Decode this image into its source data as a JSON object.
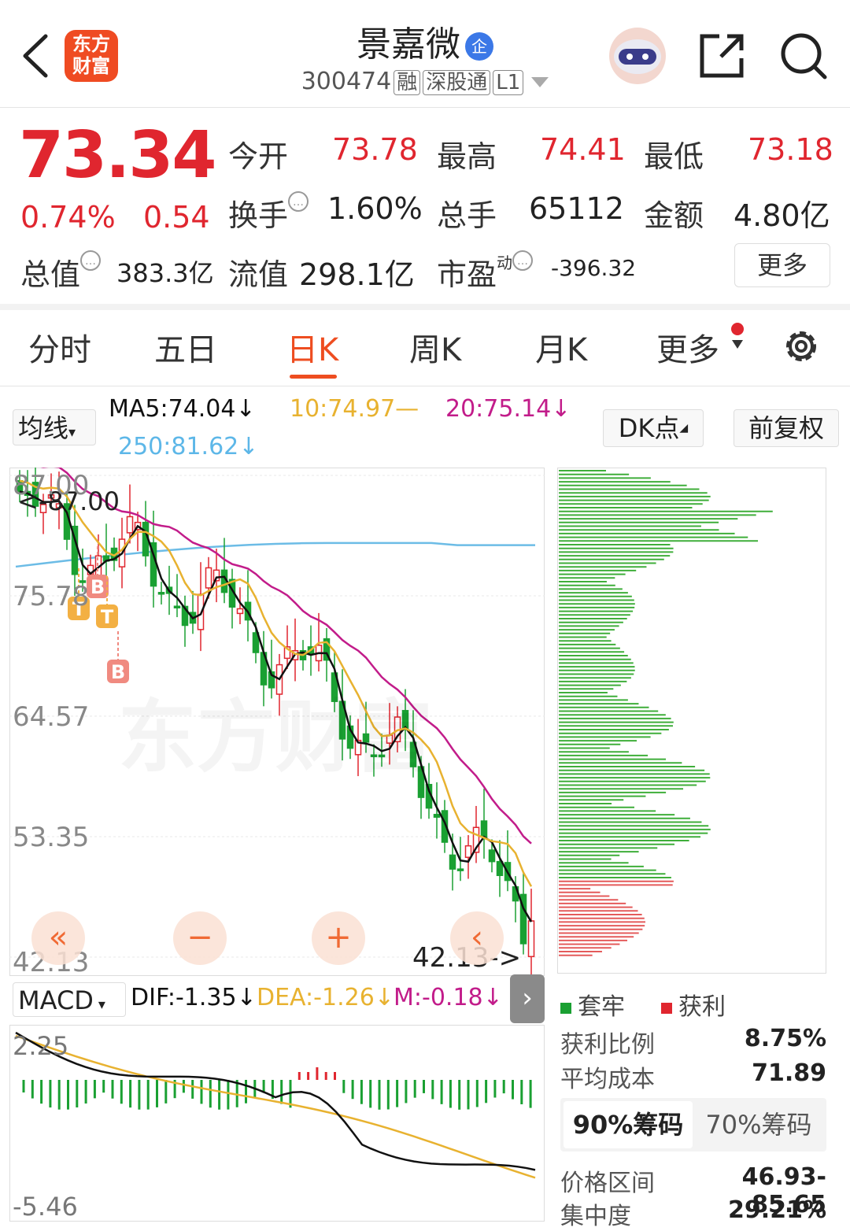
{
  "header": {
    "logo_text_line1": "东方",
    "logo_text_line2": "财富",
    "stock_name": "景嘉微",
    "badge": "企",
    "code": "300474",
    "tags": [
      "融",
      "深股通",
      "L1"
    ]
  },
  "quote": {
    "price": "73.34",
    "change_pct": "0.74%",
    "change": "0.54",
    "open_label": "今开",
    "open": "73.78",
    "high_label": "最高",
    "high": "74.41",
    "low_label": "最低",
    "low": "73.18",
    "turnover_label": "换手",
    "turnover": "1.60%",
    "volume_label": "总手",
    "volume": "65112",
    "amount_label": "金额",
    "amount": "4.80亿",
    "mcap_label": "总值",
    "mcap": "383.3亿",
    "float_label": "流值",
    "float_mcap": "298.1亿",
    "pe_label": "市盈",
    "pe_sup": "动",
    "pe": "-396.32",
    "more_label": "更多"
  },
  "tabs": [
    "分时",
    "五日",
    "日K",
    "周K",
    "月K",
    "更多"
  ],
  "active_tab": "日K",
  "toolbar": {
    "ma_select": "均线",
    "ma5": "MA5:74.04↓",
    "ma10": "10:74.97—",
    "ma20": "20:75.14↓",
    "ma250": "250:81.62↓",
    "dk_label": "DK点",
    "adjust_label": "前复权"
  },
  "kchart": {
    "y_ticks": [
      "87.00",
      "75.78",
      "64.57",
      "53.35",
      "42.13"
    ],
    "max_marker": "<-87.00",
    "min_marker": "42.13->",
    "signals": [
      "B",
      "T",
      "B",
      "T",
      "B"
    ],
    "watermark": "东方财富"
  },
  "macd": {
    "select": "MACD",
    "dif": "DIF:-1.35↓",
    "dea": "DEA:-1.26↓",
    "m": "M:-0.18↓",
    "y_top": "2.25",
    "y_bottom": "-5.46"
  },
  "chips": {
    "legend_trapped": "套牢",
    "legend_profit": "获利",
    "profit_ratio_label": "获利比例",
    "profit_ratio": "8.75%",
    "avg_cost_label": "平均成本",
    "avg_cost": "71.89",
    "tab_90": "90%筹码",
    "tab_70": "70%筹码",
    "range_label": "价格区间",
    "range": "46.93-85.65",
    "concentration_label": "集中度",
    "concentration": "29.21%"
  },
  "colors": {
    "up": "#e0262f",
    "down": "#1aa032",
    "accent": "#ee4d20",
    "ma5": "#111111",
    "ma10": "#e8b230",
    "ma20": "#c21c8a",
    "ma250": "#6cbce6"
  }
}
